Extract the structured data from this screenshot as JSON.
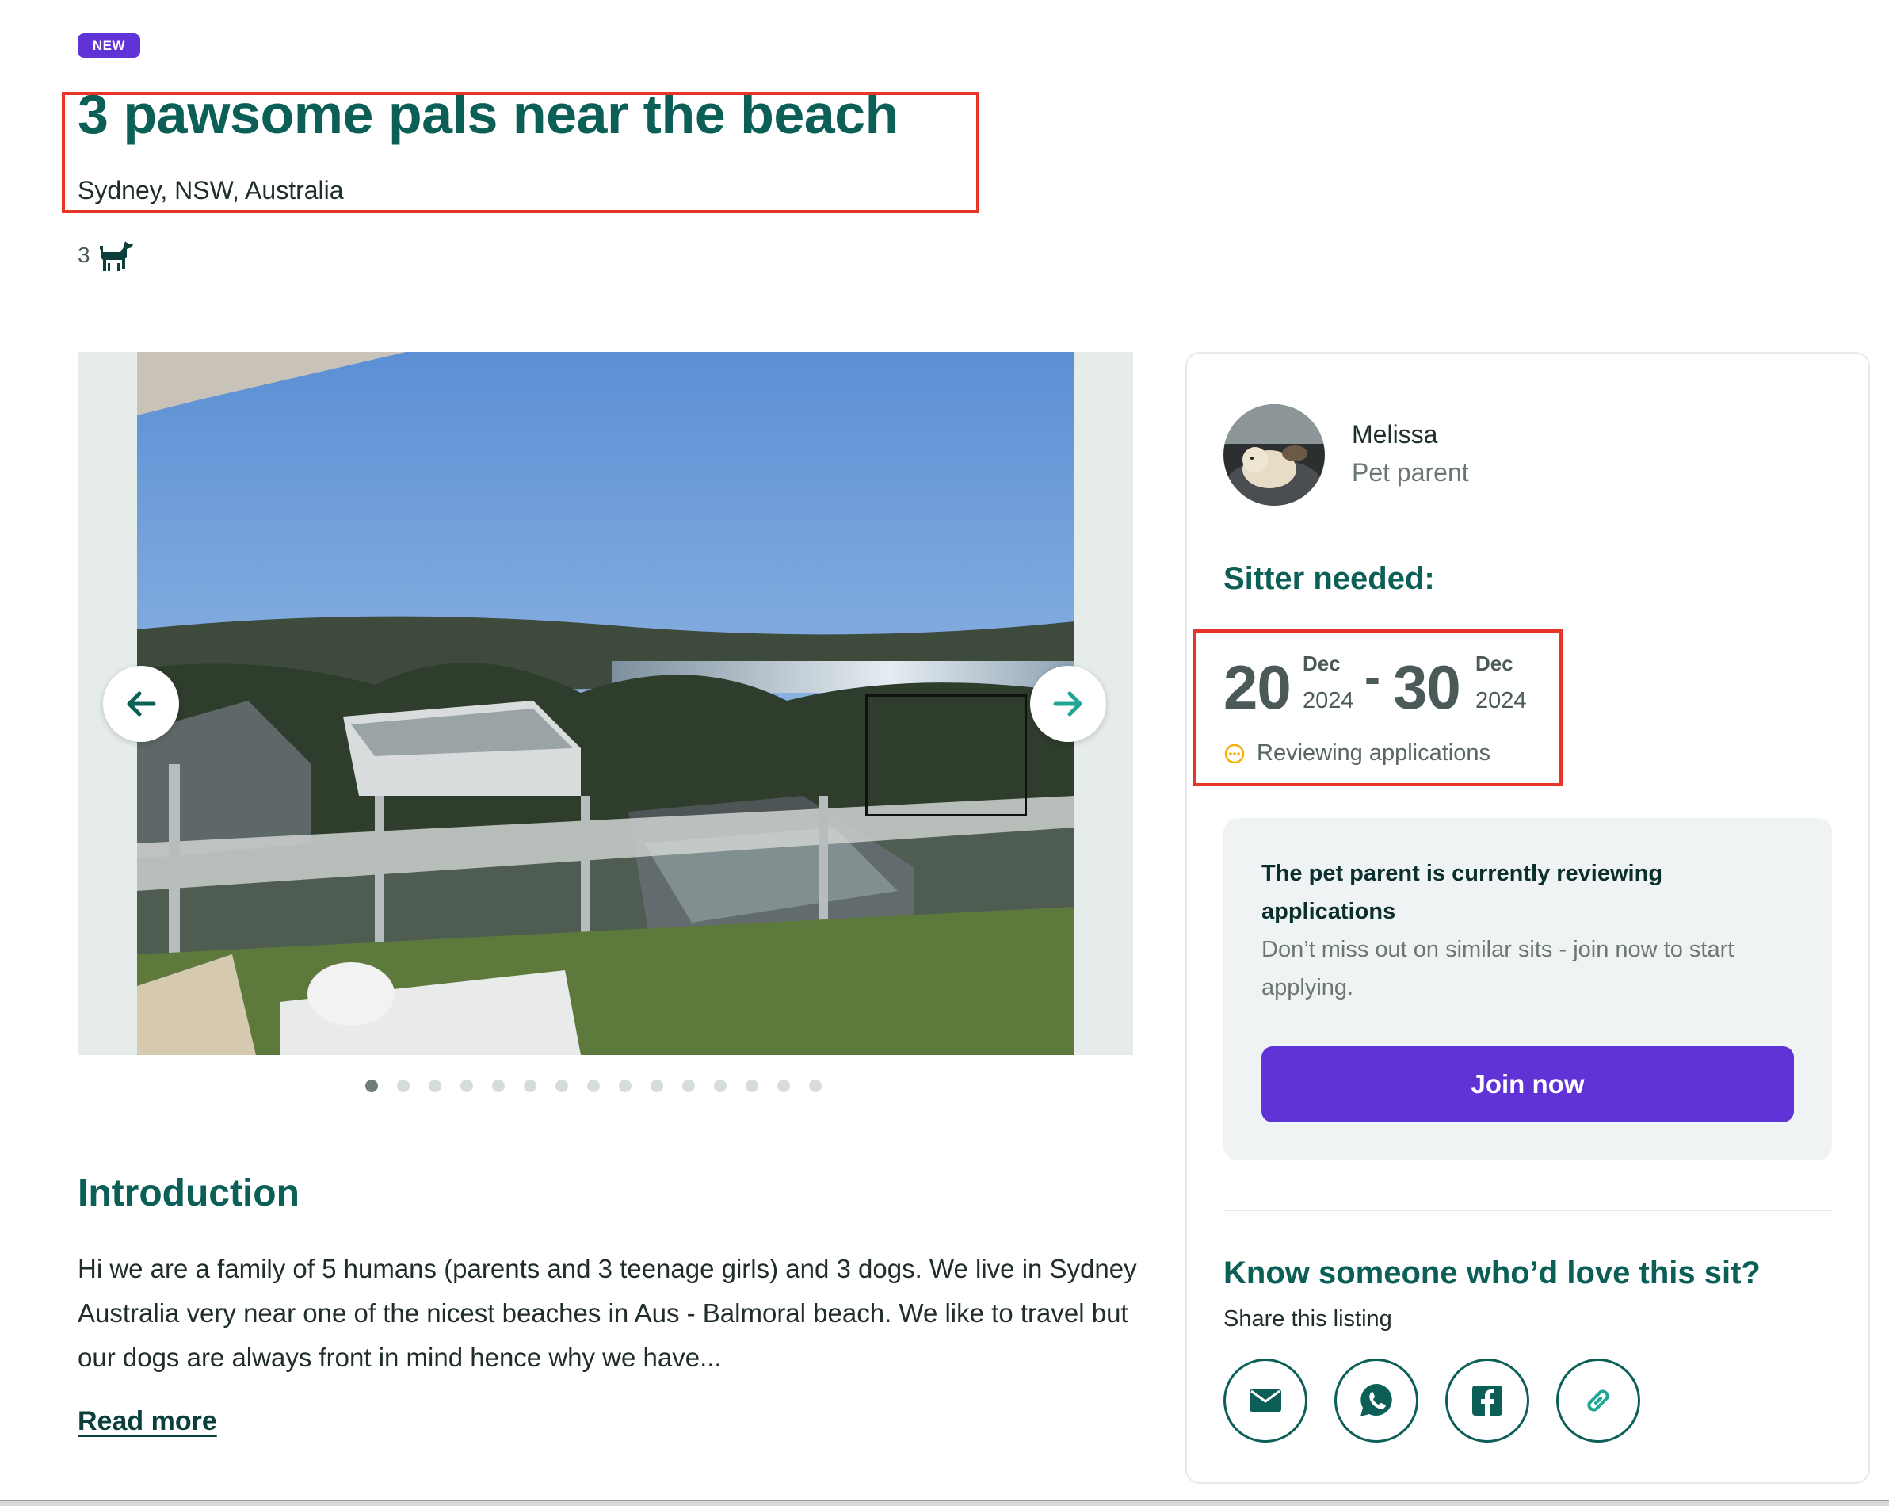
{
  "listing": {
    "badge": "NEW",
    "title": "3 pawsome pals near the beach",
    "location": "Sydney, NSW, Australia",
    "pet_count": "3"
  },
  "gallery": {
    "dot_count": 15,
    "active_index": 0
  },
  "introduction": {
    "heading": "Introduction",
    "text": "Hi we are a family of 5 humans (parents and 3 teenage girls) and 3 dogs. We live in Sydney Australia very near one of the nicest beaches in Aus - Balmoral beach. We like to travel but our dogs are always front in mind hence why we have...",
    "read_more": "Read more"
  },
  "owner": {
    "name": "Melissa",
    "role": "Pet parent"
  },
  "sitter": {
    "heading": "Sitter needed:",
    "start_day": "20",
    "start_month": "Dec",
    "start_year": "2024",
    "separator": "-",
    "end_day": "30",
    "end_month": "Dec",
    "end_year": "2024",
    "status": "Reviewing applications"
  },
  "review_panel": {
    "title": "The pet parent is currently reviewing applications",
    "body": "Don’t miss out on similar sits - join now to start applying.",
    "button": "Join now"
  },
  "share": {
    "heading": "Know someone who’d love this sit?",
    "subtitle": "Share this listing",
    "buttons": [
      "mail-icon",
      "whatsapp-icon",
      "facebook-icon",
      "link-icon"
    ]
  },
  "colors": {
    "brand_teal": "#0b5f57",
    "accent_purple": "#5f33d6",
    "highlight_red": "#e8352a",
    "status_amber": "#f2b100"
  }
}
